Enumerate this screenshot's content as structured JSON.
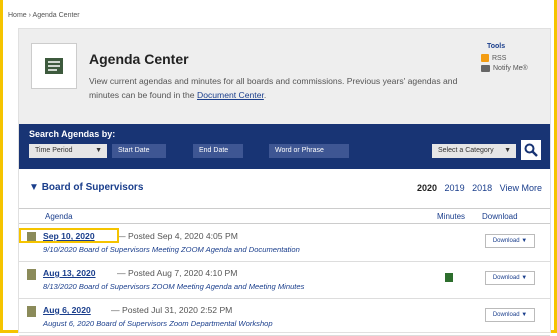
{
  "breadcrumb": {
    "home": "Home",
    "sep": "›",
    "current": "Agenda Center"
  },
  "header": {
    "title": "Agenda Center",
    "description_pre": "View current agendas and minutes for all boards and commissions. Previous years' agendas and minutes can be found in the",
    "description_link": "Document Center",
    "description_post": ".",
    "logo_icon": "agenda-icon"
  },
  "tools": {
    "title": "Tools",
    "rss_label": "RSS",
    "notify_label": "Notify Me®"
  },
  "search": {
    "label": "Search Agendas by:",
    "time_period": "Time Period",
    "start_date": "Start Date",
    "end_date": "End Date",
    "word_phrase": "Word or Phrase",
    "category": "Select a Category"
  },
  "section": {
    "title": "Board of Supervisors",
    "years": [
      "2020",
      "2019",
      "2018"
    ],
    "view_more": "View More"
  },
  "columns": {
    "agenda": "Agenda",
    "minutes": "Minutes",
    "download": "Download"
  },
  "rows": [
    {
      "date": "Sep 10, 2020",
      "posted": "— Posted Sep 4, 2020 4:05 PM",
      "subtitle": "9/10/2020 Board of Supervisors Meeting ZOOM Agenda and Documentation",
      "has_minutes": false,
      "download_label": "Download ▼"
    },
    {
      "date": "Aug 13, 2020",
      "posted": "— Posted Aug 7, 2020 4:10 PM",
      "subtitle": "8/13/2020 Board of Supervisors ZOOM Meeting Agenda and Meeting Minutes",
      "has_minutes": true,
      "download_label": "Download ▼"
    },
    {
      "date": "Aug 6, 2020",
      "posted": "— Posted Jul 31, 2020 2:52 PM",
      "subtitle": "August 6, 2020 Board of Supervisors Zoom Departmental Workshop",
      "has_minutes": false,
      "download_label": "Download ▼"
    }
  ],
  "colors": {
    "accent": "#f5c400",
    "navy": "#183474",
    "link": "#1a3e8c"
  }
}
